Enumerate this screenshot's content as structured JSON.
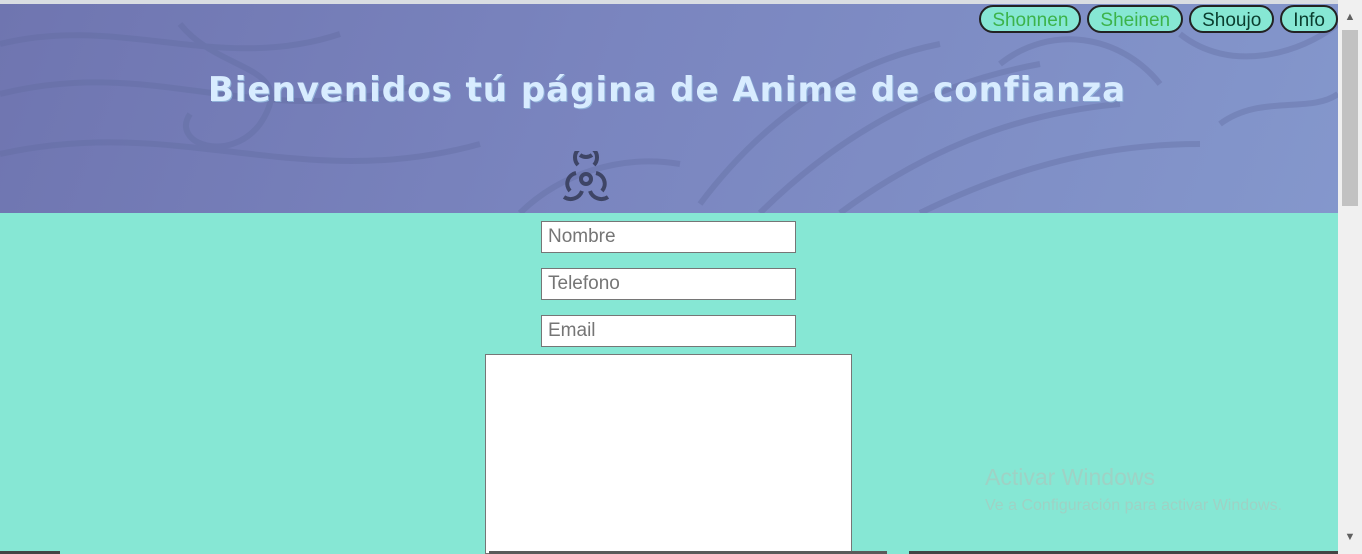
{
  "header": {
    "title": "Bienvenidos tú página de Anime de confianza",
    "logo_icon": "biohazard-icon",
    "background": "#7a85bf"
  },
  "nav": {
    "items": [
      {
        "label": "Shonnen"
      },
      {
        "label": "Sheinen"
      },
      {
        "label": "Shoujo"
      },
      {
        "label": "Info"
      }
    ]
  },
  "form": {
    "name_placeholder": "Nombre",
    "phone_placeholder": "Telefono",
    "email_placeholder": "Email",
    "message_value": ""
  },
  "watermark": {
    "line1": "Activar Windows",
    "line2": "Ve a Configuración para activar Windows."
  },
  "colors": {
    "page_bg": "#86e7d4",
    "nav_text_green": "#3cb34a",
    "nav_text_dark": "#0a3d2e"
  }
}
